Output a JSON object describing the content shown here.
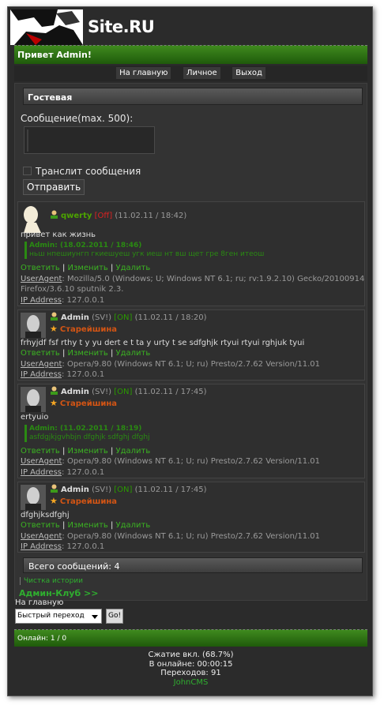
{
  "brand": {
    "site": "Site.RU"
  },
  "greeting": "Привет Admin!",
  "nav": [
    "На главную",
    "Личное",
    "Выход"
  ],
  "guestbook": {
    "title": "Гостевая",
    "message_label": "Сообщение(max. 500):",
    "translit_label": "Транслит сообщения",
    "send_label": "Отправить"
  },
  "posts": [
    {
      "nick": "qwerty",
      "status": "[Off]",
      "time": "(11.02.11 / 18:42)",
      "text": "привет как жизнь",
      "quote_head": "Admin: (18.02.2011 / 18:46)",
      "quote_body": "ньш нпешиунгп гкиешуеш угк иеш нт вш щет гре 8ген итеош",
      "actions": "Ответить",
      "actions2": "Изменить",
      "actions3": "Удалить",
      "ua_label": "UserAgent",
      "ua": ": Mozilla/5.0 (Windows; U; Windows NT 6.1; ru; rv:1.9.2.10) Gecko/20100914",
      "ua2": "Firefox/3.6.10 sputnik 2.3.",
      "ip_label": "IP Address",
      "ip": ": 127.0.0.1"
    },
    {
      "nick": "Admin",
      "sv": "(SV!)",
      "status": "[ON]",
      "time": "(11.02.11 / 18:20)",
      "rank": "Старейшина",
      "text": "frhyjdf fsf rthy t y yu dert e t ta y urty t se sdfghjk rtyui rtyui rghjuk tyui",
      "ua": ": Opera/9.80 (Windows NT 6.1; U; ru) Presto/2.7.62 Version/11.01",
      "ip": ": 127.0.0.1"
    },
    {
      "nick": "Admin",
      "sv": "(SV!)",
      "status": "[ON]",
      "time": "(11.02.11 / 17:45)",
      "rank": "Старейшина",
      "text": "ertyuio",
      "quote_head": "Admin: (11.02.2011 / 18:19)",
      "quote_body": "asfdgjkjgvhbjn dfghjk sdfghj dfghj",
      "ua": ": Opera/9.80 (Windows NT 6.1; U; ru) Presto/2.7.62 Version/11.01",
      "ip": ": 127.0.0.1"
    },
    {
      "nick": "Admin",
      "sv": "(SV!)",
      "status": "[ON]",
      "time": "(11.02.11 / 17:45)",
      "rank": "Старейшина",
      "text": "dfghjksdfghj",
      "ua": ": Opera/9.80 (Windows NT 6.1; U; ru) Presto/2.7.62 Version/11.01",
      "ip": ": 127.0.0.1"
    }
  ],
  "total": "Всего сообщений: 4",
  "clear_history": "Чистка истории",
  "admin_club": "Админ-Клуб >>",
  "home_link": "На главную",
  "quick_jump": "Быстрый переход",
  "go": "Go!",
  "online": "Онлайн: 1 / 0",
  "footer": [
    "Сжатие вкл. (68.7%)",
    "В онлайне: 00:00:15",
    "Переходов: 91",
    "JohnCMS"
  ],
  "colors": {
    "green_bar": "#2f7514",
    "link_green": "#3bb322",
    "rank": "#d45514",
    "off": "#dd2222"
  }
}
